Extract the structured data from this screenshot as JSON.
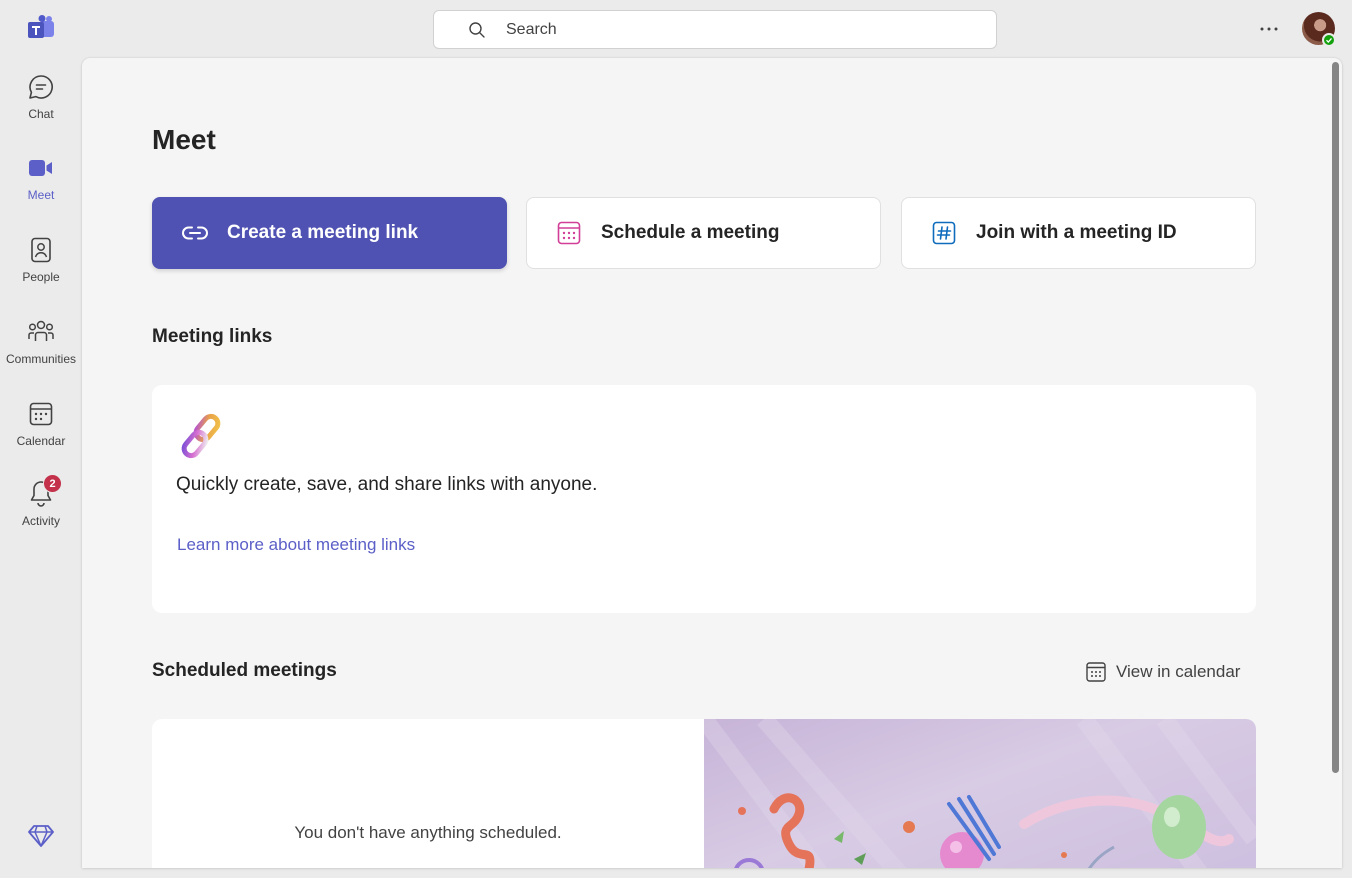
{
  "header": {
    "search_placeholder": "Search"
  },
  "rail": {
    "items": [
      {
        "label": "Chat"
      },
      {
        "label": "Meet"
      },
      {
        "label": "People"
      },
      {
        "label": "Communities"
      },
      {
        "label": "Calendar"
      },
      {
        "label": "Activity",
        "badge": "2"
      }
    ]
  },
  "main": {
    "title": "Meet",
    "actions": [
      {
        "label": "Create a meeting link"
      },
      {
        "label": "Schedule a meeting"
      },
      {
        "label": "Join with a meeting ID"
      }
    ],
    "meeting_links": {
      "title": "Meeting links",
      "description": "Quickly create, save, and share links with anyone.",
      "learn_more": "Learn more about meeting links"
    },
    "scheduled": {
      "title": "Scheduled meetings",
      "view_in_calendar": "View in calendar",
      "empty_text": "You don't have anything scheduled."
    }
  },
  "colors": {
    "accent": "#5b5fc7",
    "primary_button": "#4f52b2",
    "badge": "#c4314b",
    "presence": "#13a10e"
  },
  "icons": [
    "teams-logo-icon",
    "search-icon",
    "more-icon",
    "chat-icon",
    "video-icon",
    "people-icon",
    "communities-icon",
    "calendar-icon",
    "bell-icon",
    "diamond-icon",
    "link-icon",
    "calendar-schedule-icon",
    "hash-icon"
  ]
}
